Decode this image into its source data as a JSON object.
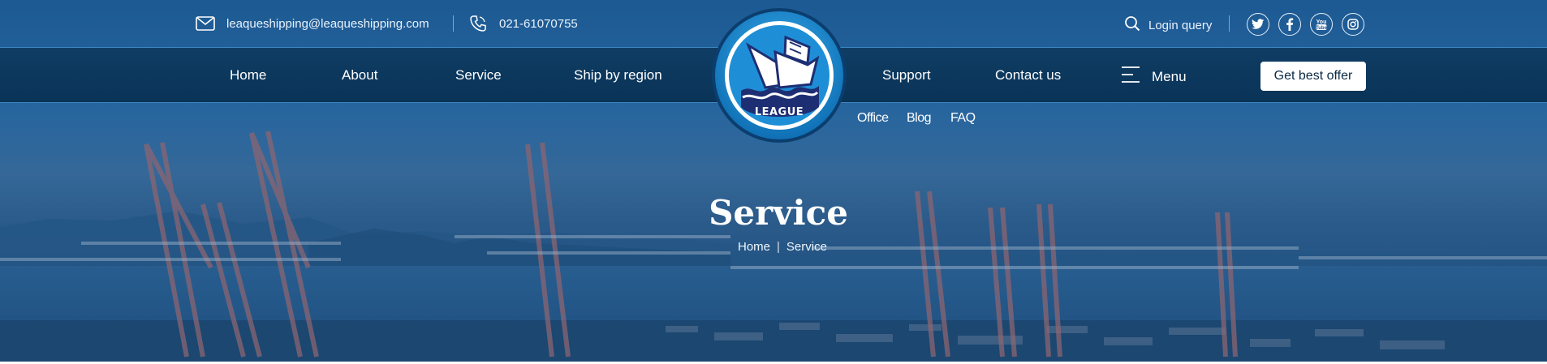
{
  "header": {
    "email": "leaqueshipping@leaqueshipping.com",
    "phone": "021-61070755",
    "login_label": "Login query",
    "socials": [
      "twitter-icon",
      "facebook-icon",
      "youtube-icon",
      "instagram-icon"
    ]
  },
  "nav": {
    "items": [
      "Home",
      "About",
      "Service",
      "Ship by region",
      "Support",
      "Contact us"
    ],
    "menu_label": "Menu",
    "offer_label": "Get best offer"
  },
  "logo": {
    "text": "LEAGUE"
  },
  "submenu": {
    "items": [
      "Office",
      "Blog",
      "FAQ"
    ]
  },
  "page": {
    "title": "Service",
    "breadcrumb": [
      "Home",
      "Service"
    ]
  },
  "colors": {
    "nav_bg": "#0a3357",
    "hero_overlay": "#1f5a92",
    "logo_blue": "#1e8fd6",
    "logo_navy": "#1e2e73"
  }
}
